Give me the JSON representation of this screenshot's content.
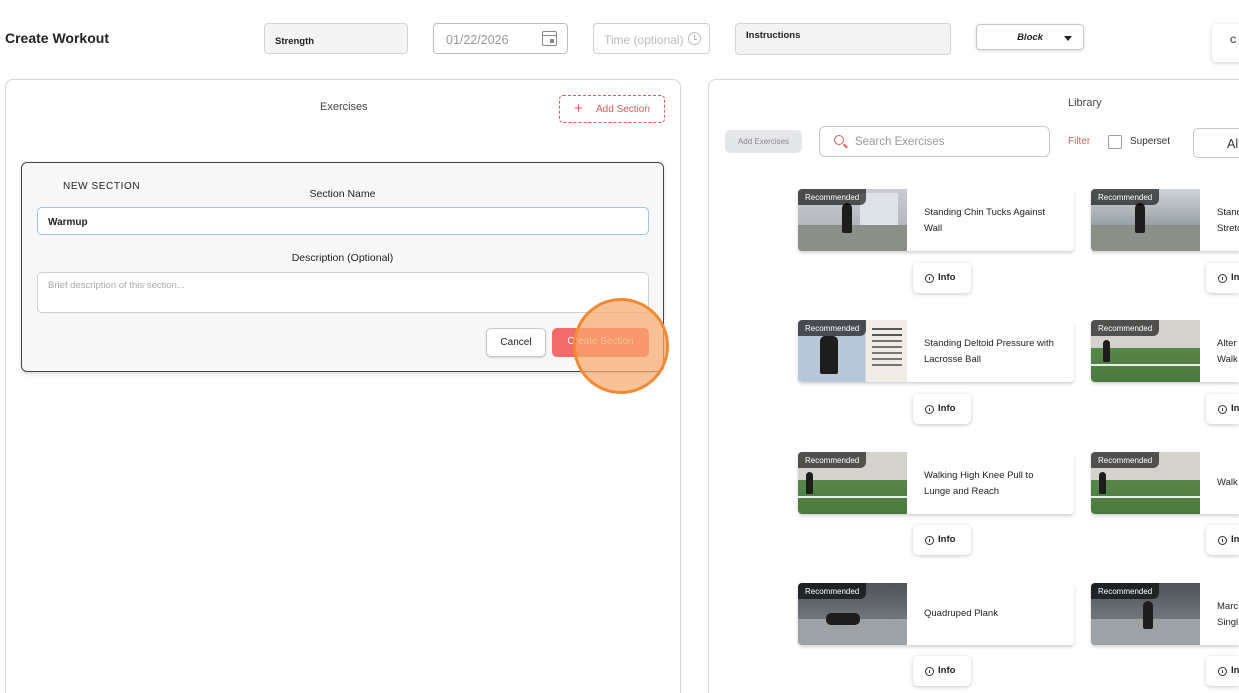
{
  "header": {
    "title": "Create Workout",
    "workout_type": "Strength",
    "date_value": "01/22/2026",
    "time_placeholder": "Time (optional)",
    "instructions_label": "Instructions",
    "block_label": "Block",
    "edge_button_label": "C"
  },
  "exercises_panel": {
    "title": "Exercises",
    "add_section_label": "Add Section",
    "new_section": {
      "heading": "NEW SECTION",
      "name_label": "Section Name",
      "name_value": "Warmup",
      "description_label": "Description (Optional)",
      "description_placeholder": "Brief description of this section...",
      "cancel_label": "Cancel",
      "create_label": "Create Section"
    }
  },
  "library_panel": {
    "title": "Library",
    "add_exercises_label": "Add Exercises",
    "search_placeholder": "Search Exercises",
    "filter_label": "Filter",
    "superset_label": "Superset",
    "all_label": "Al",
    "badge_label": "Recommended",
    "info_label": "Info",
    "col1": [
      {
        "title": "Standing Chin Tucks Against Wall"
      },
      {
        "title": "Standing Deltoid Pressure with Lacrosse Ball"
      },
      {
        "title": "Walking High Knee Pull to Lunge and Reach"
      },
      {
        "title": "Quadruped Plank"
      }
    ],
    "col2": [
      {
        "title": "Standi\nStretc",
        "info": "In"
      },
      {
        "title": "Alter\nWalk",
        "info": "In"
      },
      {
        "title": "Walk",
        "info": "In"
      },
      {
        "title": "Marc\nSingl",
        "info": "In"
      }
    ]
  },
  "colors": {
    "accent": "#e05a5a",
    "create_button": "#f26a6a",
    "click_ring": "#f08a33"
  }
}
